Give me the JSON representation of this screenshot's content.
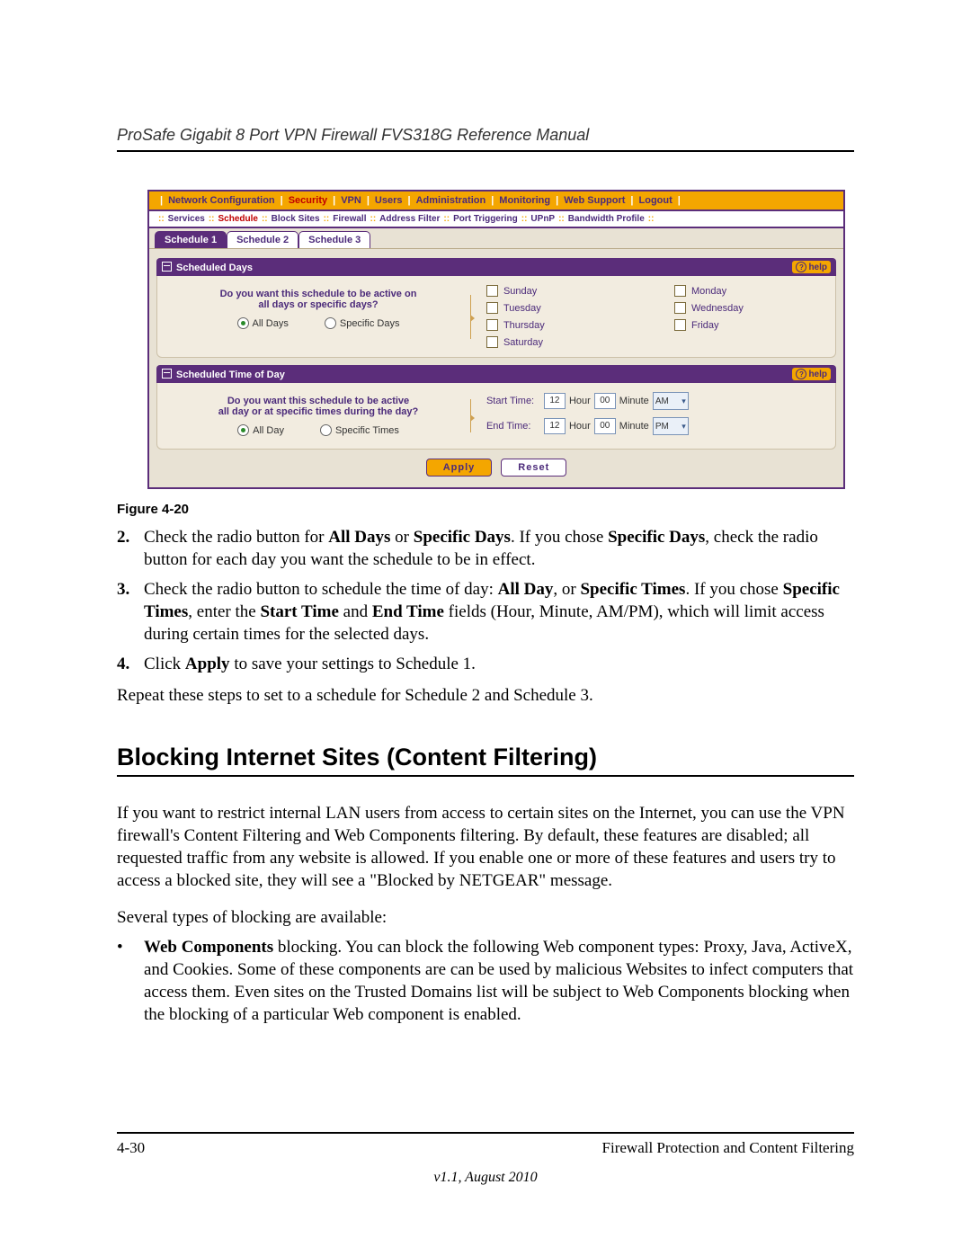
{
  "header": {
    "title": "ProSafe Gigabit 8 Port VPN Firewall FVS318G Reference Manual"
  },
  "ui": {
    "main_nav": [
      "Network Configuration",
      "Security",
      "VPN",
      "Users",
      "Administration",
      "Monitoring",
      "Web Support",
      "Logout"
    ],
    "main_nav_active_index": 1,
    "sub_nav": [
      "Services",
      "Schedule",
      "Block Sites",
      "Firewall",
      "Address Filter",
      "Port Triggering",
      "UPnP",
      "Bandwidth Profile"
    ],
    "sub_nav_active_index": 1,
    "tabs": [
      "Schedule 1",
      "Schedule 2",
      "Schedule 3"
    ],
    "tabs_active_index": 0,
    "help_label": "help",
    "days_section": {
      "title": "Scheduled Days",
      "question_l1": "Do you want this schedule to be active on",
      "question_l2": "all days or specific days?",
      "radio_all": "All Days",
      "radio_specific": "Specific Days",
      "days": [
        "Sunday",
        "Monday",
        "Tuesday",
        "Wednesday",
        "Thursday",
        "Friday",
        "Saturday"
      ]
    },
    "time_section": {
      "title": "Scheduled Time of Day",
      "question_l1": "Do you want this schedule to be active",
      "question_l2": "all day or at specific times during the day?",
      "radio_all": "All Day",
      "radio_specific": "Specific Times",
      "start_label": "Start Time:",
      "end_label": "End Time:",
      "hour_label": "Hour",
      "minute_label": "Minute",
      "start_hour": "12",
      "start_minute": "00",
      "start_ampm": "AM",
      "end_hour": "12",
      "end_minute": "00",
      "end_ampm": "PM"
    },
    "apply_label": "Apply",
    "reset_label": "Reset"
  },
  "figure_caption": "Figure 4-20",
  "step2": {
    "num": "2.",
    "t1": "Check the radio button for ",
    "b1": "All Days",
    "t2": " or ",
    "b2": "Specific Days",
    "t3": ". If you chose ",
    "b3": "Specific Days",
    "t4": ", check the radio button for each day you want the schedule to be in effect."
  },
  "step3": {
    "num": "3.",
    "t1": "Check the radio button to schedule the time of day: ",
    "b1": "All Day",
    "t2": ", or ",
    "b2": "Specific Times",
    "t3": ". If you chose ",
    "b3": "Specific Times",
    "t4": ", enter the ",
    "b4": "Start Time",
    "t5": " and ",
    "b5": "End Time",
    "t6": " fields (Hour, Minute, AM/PM), which will limit access during certain times for the selected days."
  },
  "step4": {
    "num": "4.",
    "t1": "Click ",
    "b1": "Apply",
    "t2": " to save your settings to Schedule 1."
  },
  "repeat_line": "Repeat these steps to set to a schedule for Schedule 2 and Schedule 3.",
  "section_heading": "Blocking Internet Sites (Content Filtering)",
  "para1": "If you want to restrict internal LAN users from access to certain sites on the Internet, you can use the VPN firewall's Content Filtering and Web Components filtering. By default, these features are disabled; all requested traffic from any website is allowed. If you enable one or more of these features and users try to access a blocked site, they will see a \"Blocked by NETGEAR\" message.",
  "para2": "Several types of blocking are available:",
  "bullet1": {
    "b": "Web Components",
    "t": " blocking. You can block the following Web component types: Proxy, Java, ActiveX, and Cookies. Some of these components are can be used by malicious Websites to infect computers that access them. Even sites on the Trusted Domains list will be subject to Web Components blocking when the blocking of a particular Web component is enabled."
  },
  "footer": {
    "page": "4-30",
    "chapter": "Firewall Protection and Content Filtering",
    "version": "v1.1, August 2010"
  }
}
